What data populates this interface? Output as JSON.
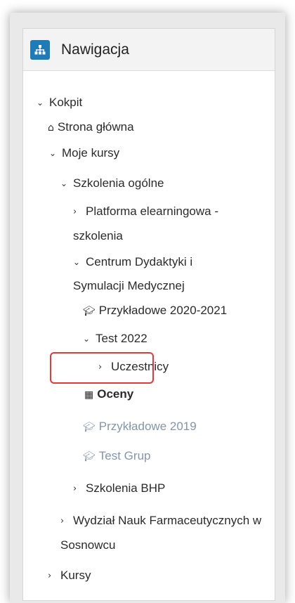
{
  "panel": {
    "title": "Nawigacja",
    "icon": "sitemap-icon",
    "accent_color": "#1f7ab8"
  },
  "tree": {
    "kokpit": "Kokpit",
    "strona_glowna": "Strona główna",
    "moje_kursy": "Moje kursy",
    "szkolenia_ogolne": "Szkolenia ogólne",
    "platforma": "Platforma elearningowa - szkolenia",
    "centrum": "Centrum Dydaktyki i Symulacji Medycznej",
    "przykladowe_2020": "Przykładowe 2020-2021",
    "test_2022": "Test 2022",
    "uczestnicy": "Uczestnicy",
    "oceny": "Oceny",
    "przykladowe_2019": "Przykładowe 2019",
    "test_grup": "Test Grup",
    "szkolenia_bhp": "Szkolenia BHP",
    "wydzial": "Wydział Nauk Farmaceutycznych w Sosnowcu",
    "kursy": "Kursy"
  },
  "highlight_color": "#e03a3a"
}
